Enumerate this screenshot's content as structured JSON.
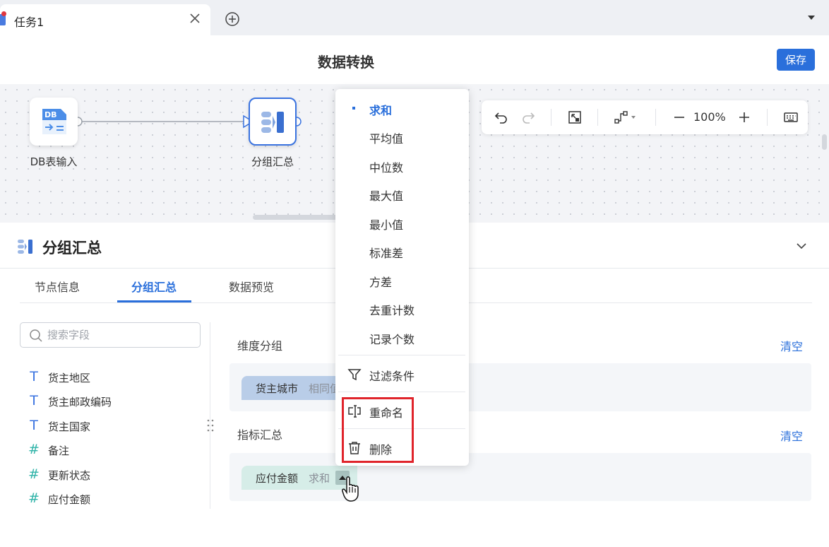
{
  "window": {
    "tab_title": "任务1",
    "icons": [
      "close-icon",
      "plus-circle-icon",
      "caret-down-icon"
    ]
  },
  "header": {
    "title": "数据转换",
    "save_label": "保存"
  },
  "canvas": {
    "nodes": [
      {
        "label": "DB表输入",
        "icon_text": "DB"
      },
      {
        "label": "分组汇总"
      }
    ],
    "toolbar": {
      "zoom": "100%",
      "icons": [
        "undo-icon",
        "redo-icon",
        "fit-view-icon",
        "connector-style-icon",
        "zoom-out-icon",
        "zoom-in-icon",
        "keyboard-icon"
      ]
    }
  },
  "panel": {
    "title": "分组汇总",
    "tabs": [
      "节点信息",
      "分组汇总",
      "数据预览"
    ],
    "active_tab": 1,
    "search_placeholder": "搜索字段",
    "fields": [
      {
        "type_icon": "T",
        "label": "货主地区"
      },
      {
        "type_icon": "T",
        "label": "货主邮政编码"
      },
      {
        "type_icon": "T",
        "label": "货主国家"
      },
      {
        "type_icon": "#",
        "label": "备注"
      },
      {
        "type_icon": "#",
        "label": "更新状态"
      },
      {
        "type_icon": "#",
        "label": "应付金额"
      }
    ],
    "dimension_section": {
      "label": "维度分组",
      "clear": "清空",
      "chip": {
        "name": "货主城市",
        "agg": "相同值"
      }
    },
    "metric_section": {
      "label": "指标汇总",
      "clear": "清空",
      "chip": {
        "name": "应付金额",
        "agg": "求和"
      }
    }
  },
  "menu": {
    "aggregations": [
      "求和",
      "平均值",
      "中位数",
      "最大值",
      "最小值",
      "标准差",
      "方差",
      "去重计数",
      "记录个数"
    ],
    "selected": "求和",
    "filter": "过滤条件",
    "rename": "重命名",
    "delete": "删除"
  },
  "colors": {
    "accent": "#2a6fdb",
    "highlight": "#e0242b",
    "field_icon": "#2fb3a8"
  }
}
